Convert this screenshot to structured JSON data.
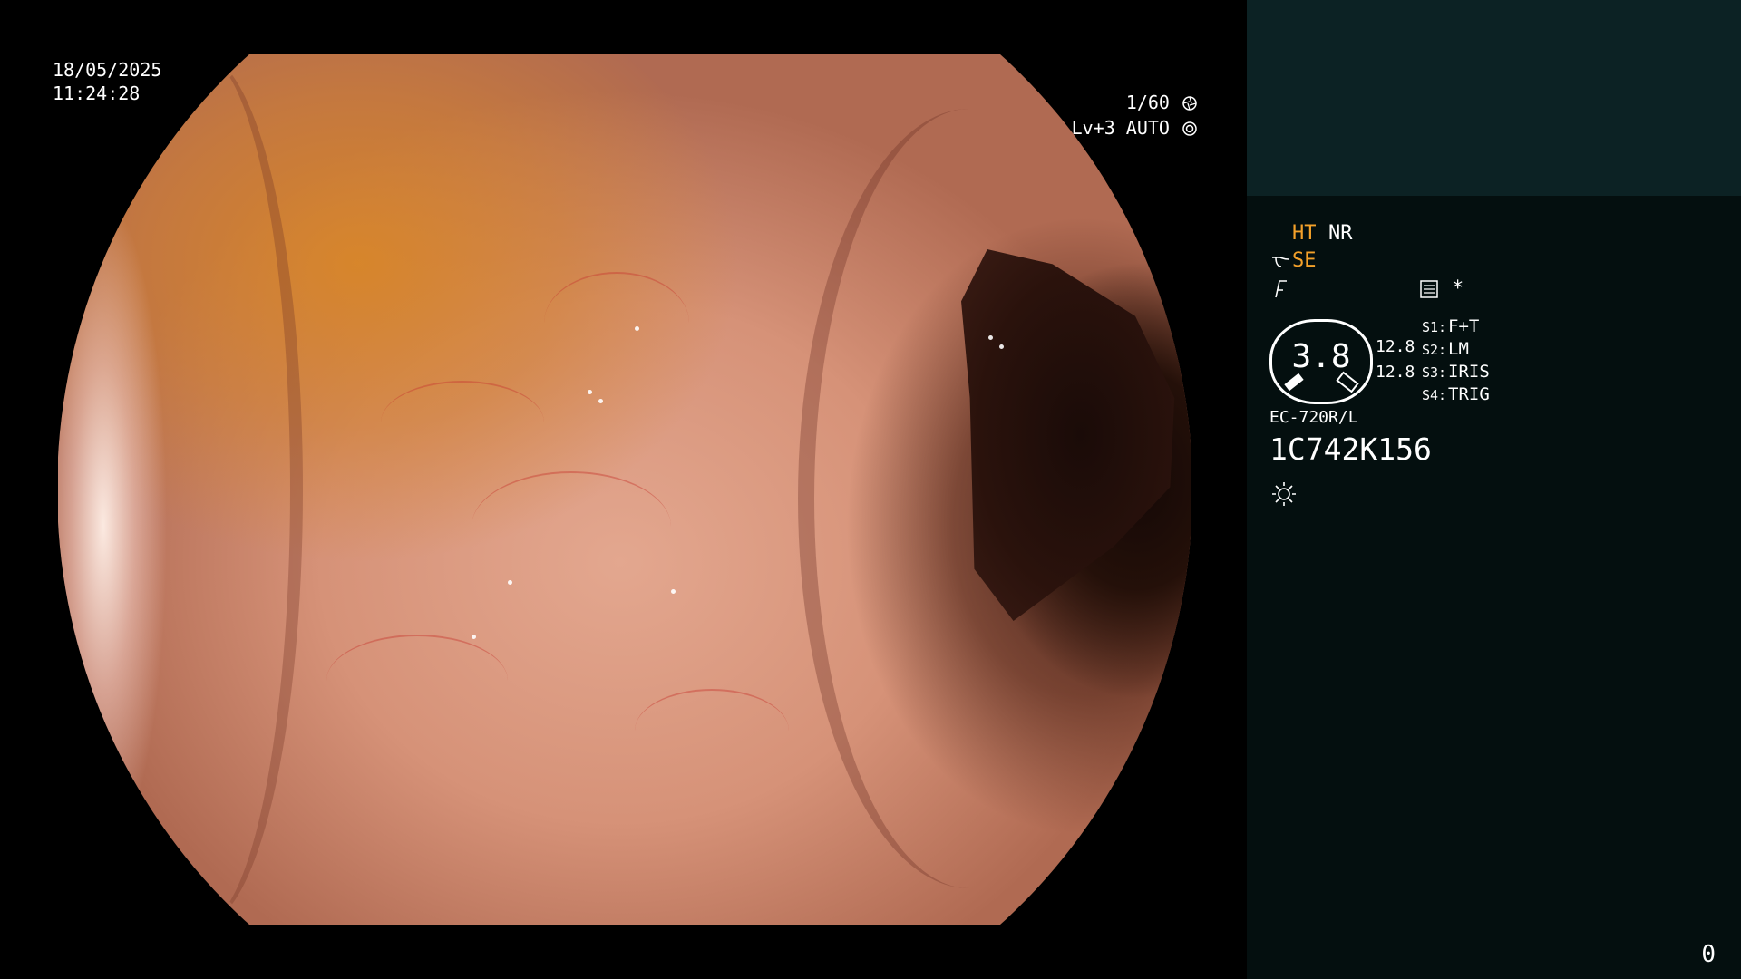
{
  "overlay": {
    "date": "18/05/2025",
    "time": "11:24:28",
    "shutter": "1/60",
    "shutter_icon": "shutter-icon",
    "level": "Lv+3 AUTO",
    "iris_icon": "iris-auto-icon"
  },
  "panel": {
    "ht": "HT",
    "nr": "NR",
    "se": "SE",
    "se_icon": "enhancement-wave-icon",
    "struct_icon": "structure-enhance-icon",
    "memo_icon": "memo-icon",
    "star": "*",
    "gauge_value": "3.8",
    "values": [
      "12.8",
      "12.8"
    ],
    "switches": [
      {
        "key": "S1:",
        "value": "F+T"
      },
      {
        "key": "S2:",
        "value": "LM"
      },
      {
        "key": "S3:",
        "value": "IRIS"
      },
      {
        "key": "S4:",
        "value": "TRIG"
      }
    ],
    "scope_model": "EC-720R/L",
    "serial": "1C742K156",
    "light_icon": "light-sun-icon",
    "page_number": "0"
  },
  "colors": {
    "panel_top": "#0c2224",
    "panel_bg": "#040f0f",
    "accent_orange": "#f4a12a"
  }
}
